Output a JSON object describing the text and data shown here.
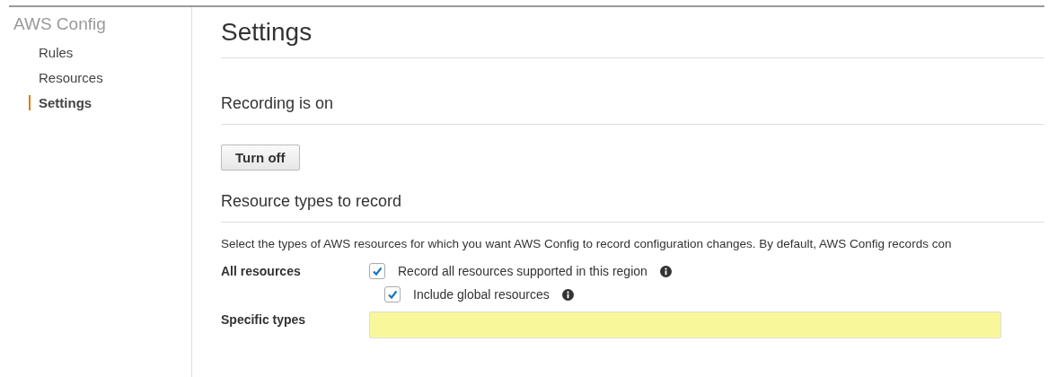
{
  "sidebar": {
    "title": "AWS Config",
    "items": [
      {
        "label": "Rules",
        "selected": false
      },
      {
        "label": "Resources",
        "selected": false
      },
      {
        "label": "Settings",
        "selected": true
      }
    ]
  },
  "page_title": "Settings",
  "recording": {
    "heading": "Recording is on",
    "button": "Turn off"
  },
  "resource_types": {
    "heading": "Resource types to record",
    "description": "Select the types of AWS resources for which you want AWS Config to record configuration changes. By default, AWS Config records con",
    "all_resources": {
      "label": "All resources",
      "options": [
        {
          "label": "Record all resources supported in this region",
          "checked": true
        },
        {
          "label": "Include global resources",
          "checked": true
        }
      ]
    },
    "specific_types": {
      "label": "Specific types",
      "highlighted": true
    }
  }
}
